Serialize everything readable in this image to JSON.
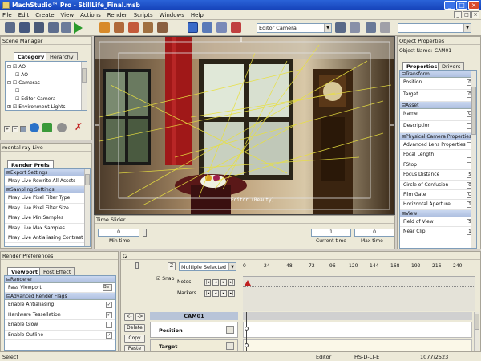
{
  "window": {
    "title": "MachStudio™ Pro - StillLife_Final.msb",
    "btn_min": "_",
    "btn_max": "□",
    "btn_close": "×"
  },
  "menu": [
    "File",
    "Edit",
    "Create",
    "View",
    "Actions",
    "Render",
    "Scripts",
    "Windows",
    "Help"
  ],
  "toolbar": {
    "camera_select": "Editor Camera"
  },
  "scene_manager": {
    "title": "Scene Manager",
    "tabs": [
      "Category",
      "Herarchy"
    ],
    "tree": [
      "AO",
      "AO",
      "Cameras",
      "",
      "Editor Camera",
      "Environment Lights"
    ]
  },
  "render_live": {
    "title": "mental ray Live",
    "tab": "Render Prefs",
    "sections": [
      {
        "header": "Export Settings",
        "rows": [
          "Mray Live Rewrite All Assets"
        ]
      },
      {
        "header": "Sampling Settings",
        "rows": [
          "Mray Live Pixel Filter Type",
          "Mray Live Pixel Filter Size",
          "Mray Live Min Samples",
          "Mray Live Max Samples",
          "Mray Live Antialiasing Contrast"
        ]
      }
    ]
  },
  "viewport": {
    "label": "Editor (Beauty)"
  },
  "time_slider": {
    "title": "Time Slider",
    "min_value": "0",
    "min_label": "Min time",
    "current_value": "1",
    "current_label": "Current time",
    "max_value": "0",
    "max_label": "Max time"
  },
  "object_properties": {
    "title": "Object Properties",
    "object_name_label": "Object Name:",
    "object_name": "CAM01",
    "tabs": [
      "Properties",
      "Drivers"
    ],
    "sections": [
      {
        "header": "Transform",
        "rows": [
          {
            "label": "Position",
            "value": "0"
          },
          {
            "label": "Target",
            "value": "0"
          }
        ]
      },
      {
        "header": "Asset",
        "rows": [
          {
            "label": "Name",
            "value": "C"
          },
          {
            "label": "Description",
            "value": ""
          }
        ]
      },
      {
        "header": "Physical Camera Properties",
        "rows": [
          {
            "label": "Advanced Lens Properties",
            "value": ""
          },
          {
            "label": "Focal Length",
            "value": ""
          },
          {
            "label": "FStop",
            "value": ""
          },
          {
            "label": "Focus Distance",
            "value": "5"
          },
          {
            "label": "Circle of Confusion",
            "value": "0"
          },
          {
            "label": "Film Gate",
            "value": "U"
          },
          {
            "label": "Horizontal Aperture",
            "value": "1"
          }
        ]
      },
      {
        "header": "View",
        "rows": [
          {
            "label": "Field of View",
            "value": "5"
          },
          {
            "label": "Near Clip",
            "value": "1"
          }
        ]
      }
    ]
  },
  "render_prefs": {
    "title": "Render Preferences",
    "tabs": [
      "Viewport",
      "Post Effect"
    ],
    "renderer_header": "Renderer",
    "pass_viewport": "Pass Viewport",
    "pass_value": "Be",
    "flags_header": "Advanced Render Flags",
    "flags": [
      {
        "label": "Enable Antialiasing",
        "checked": true
      },
      {
        "label": "Hardware Tessellation",
        "checked": true
      },
      {
        "label": "Enable Glow",
        "checked": false
      },
      {
        "label": "Enable Outline",
        "checked": true
      }
    ]
  },
  "timeline": {
    "title": "t2",
    "z_button": "Z",
    "selection": "Multiple Selected",
    "snap_label": "Snap",
    "notes_label": "Notes",
    "markers_label": "Markers",
    "ticks": [
      "0",
      "24",
      "48",
      "72",
      "96",
      "120",
      "144",
      "168",
      "192",
      "216",
      "240"
    ],
    "delete_label": "Delete",
    "copy_label": "Copy",
    "paste_label": "Paste",
    "track_title": "CAM01",
    "tracks": [
      "Position",
      "Target"
    ]
  },
  "status": {
    "left": "Select",
    "mode": "Editor",
    "code": "HS-D-LT-E",
    "count": "1077/2523"
  }
}
